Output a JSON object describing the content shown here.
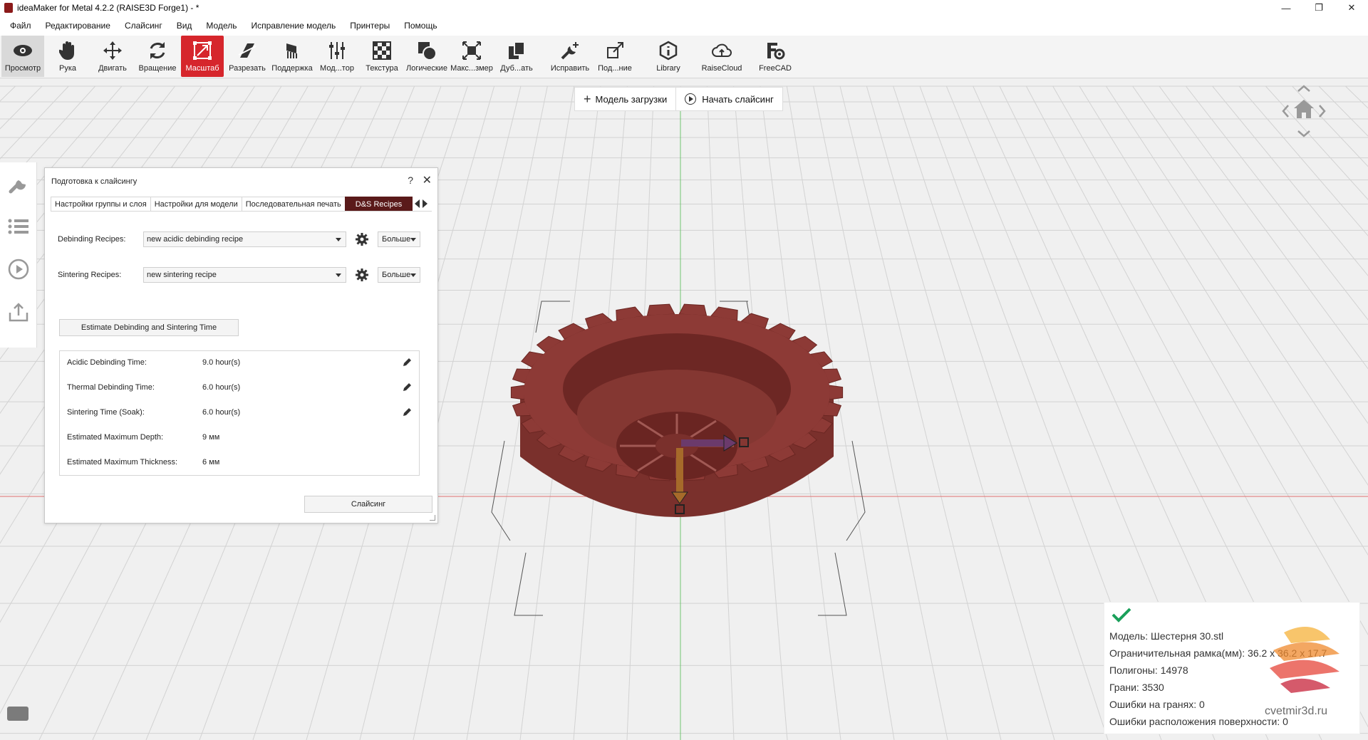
{
  "window": {
    "title": "ideaMaker for Metal 4.2.2 (RAISE3D Forge1) - *",
    "min": "—",
    "max": "❐",
    "close": "✕"
  },
  "menu": [
    "Файл",
    "Редактирование",
    "Слайсинг",
    "Вид",
    "Модель",
    "Исправление модель",
    "Принтеры",
    "Помощь"
  ],
  "toolbar": [
    {
      "label": "Просмотр",
      "icon": "eye-icon"
    },
    {
      "label": "Рука",
      "icon": "hand-icon"
    },
    {
      "label": "Двигать",
      "icon": "move-icon"
    },
    {
      "label": "Вращение",
      "icon": "rotate-icon"
    },
    {
      "label": "Масштаб",
      "icon": "scale-icon"
    },
    {
      "label": "Разрезать",
      "icon": "cut-icon"
    },
    {
      "label": "Поддержка",
      "icon": "support-icon"
    },
    {
      "label": "Мод...тор",
      "icon": "modifier-icon"
    },
    {
      "label": "Текстура",
      "icon": "texture-icon"
    },
    {
      "label": "Логические",
      "icon": "boolean-icon"
    },
    {
      "label": "Макс...змер",
      "icon": "maxsize-icon"
    },
    {
      "label": "Дуб...ать",
      "icon": "duplicate-icon"
    },
    {
      "label": "Исправить",
      "icon": "repair-icon"
    },
    {
      "label": "Под...ние",
      "icon": "connect-icon"
    },
    {
      "label": "Library",
      "icon": "library-icon"
    },
    {
      "label": "RaiseCloud",
      "icon": "cloud-icon"
    },
    {
      "label": "FreeCAD",
      "icon": "freecad-icon"
    }
  ],
  "actions": {
    "load_model": "Модель загрузки",
    "start_slicing": "Начать слайсинг"
  },
  "dialog": {
    "title": "Подготовка к слайсингу",
    "help": "?",
    "close": "✕",
    "tabs": [
      "Настройки группы и слоя",
      "Настройки для модели",
      "Последовательная печать",
      "D&S Recipes"
    ],
    "debinding_label": "Debinding Recipes:",
    "debinding_value": "new acidic debinding recipe",
    "sintering_label": "Sintering Recipes:",
    "sintering_value": "new sintering recipe",
    "more_label": "Больше",
    "estimate_button": "Estimate Debinding and Sintering Time",
    "results": [
      {
        "key": "Acidic Debinding Time:",
        "value": "9.0 hour(s)",
        "editable": true
      },
      {
        "key": "Thermal Debinding Time:",
        "value": "6.0 hour(s)",
        "editable": true
      },
      {
        "key": "Sintering Time (Soak):",
        "value": "6.0 hour(s)",
        "editable": true
      },
      {
        "key": "Estimated Maximum Depth:",
        "value": "9 мм",
        "editable": false
      },
      {
        "key": "Estimated Maximum Thickness:",
        "value": "6 мм",
        "editable": false
      }
    ],
    "slice_button": "Слайсинг"
  },
  "info": {
    "model": "Модель: Шестерня 30.stl",
    "bbox": "Ограничительная рамка(мм): 36.2 x 36.2 x 17.7",
    "polygons": "Полигоны: 14978",
    "faces": "Грани: 3530",
    "face_errors": "Ошибки на гранях: 0",
    "surface_errors": "Ошибки расположения поверхности: 0"
  },
  "watermark": "cvetmir3d.ru",
  "colors": {
    "accent": "#d6262c",
    "model": "#8a3a36",
    "tab_active": "#5a1a1a",
    "check": "#1aa05a"
  }
}
